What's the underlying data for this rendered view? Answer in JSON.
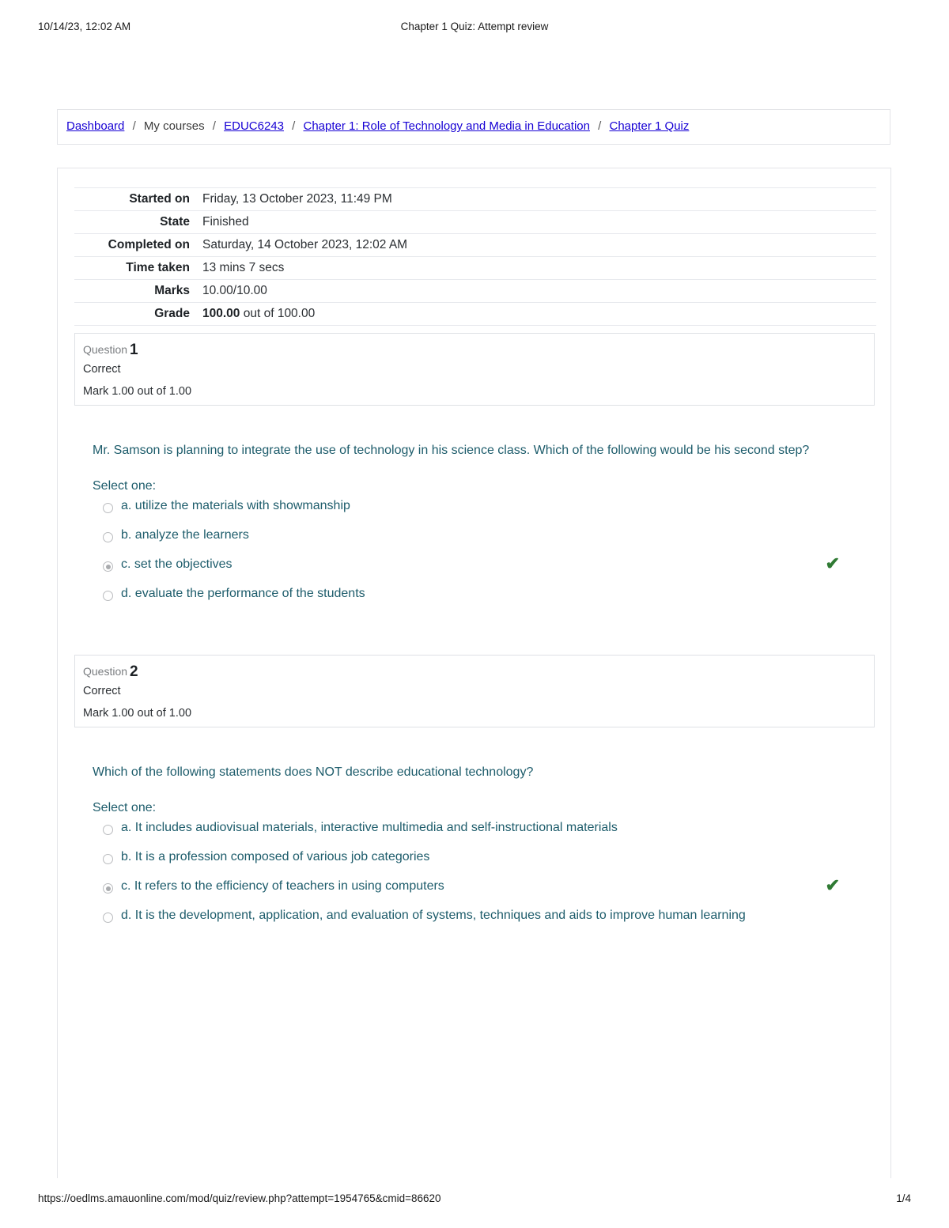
{
  "print_header": {
    "left": "10/14/23, 12:02 AM",
    "center": "Chapter 1 Quiz: Attempt review"
  },
  "print_footer": {
    "url": "https://oedlms.amauonline.com/mod/quiz/review.php?attempt=1954765&cmid=86620",
    "page": "1/4"
  },
  "breadcrumb": {
    "separator": "/",
    "items": [
      {
        "label": "Dashboard",
        "link": true
      },
      {
        "label": "My courses",
        "link": false
      },
      {
        "label": "EDUC6243",
        "link": true
      },
      {
        "label": "Chapter 1: Role of Technology and Media in Education",
        "link": true
      },
      {
        "label": "Chapter 1 Quiz",
        "link": true
      }
    ]
  },
  "summary": {
    "rows": [
      {
        "label": "Started on",
        "value": "Friday, 13 October 2023, 11:49 PM"
      },
      {
        "label": "State",
        "value": "Finished"
      },
      {
        "label": "Completed on",
        "value": "Saturday, 14 October 2023, 12:02 AM"
      },
      {
        "label": "Time taken",
        "value": "13 mins 7 secs"
      },
      {
        "label": "Marks",
        "value": "10.00/10.00"
      }
    ],
    "grade_label": "Grade",
    "grade_value_bold": "100.00",
    "grade_value_rest": "out of 100.00"
  },
  "questions": [
    {
      "number_label": "Question",
      "number": "1",
      "state": "Correct",
      "mark": "Mark 1.00 out of 1.00",
      "text": "Mr. Samson is planning to integrate the use of technology in his science class. Which of the following would be his second step?",
      "answer_label": "Select one:",
      "correct_tick": "✔",
      "options": [
        {
          "text": "a. utilize the materials with showmanship",
          "selected": false,
          "tick": false
        },
        {
          "text": "b. analyze the learners",
          "selected": false,
          "tick": false
        },
        {
          "text": "c. set the objectives",
          "selected": true,
          "tick": true
        },
        {
          "text": "d. evaluate the performance of the students",
          "selected": false,
          "tick": false
        }
      ]
    },
    {
      "number_label": "Question",
      "number": "2",
      "state": "Correct",
      "mark": "Mark 1.00 out of 1.00",
      "text": "Which of the following statements does NOT describe educational technology?",
      "answer_label": "Select one:",
      "correct_tick": "✔",
      "options": [
        {
          "text": "a. It includes audiovisual materials, interactive multimedia and self-instructional materials",
          "selected": false,
          "tick": false
        },
        {
          "text": "b. It is a profession composed of various job categories",
          "selected": false,
          "tick": false
        },
        {
          "text": "c. It refers to the efficiency of teachers in using computers",
          "selected": true,
          "tick": true
        },
        {
          "text": "d. It is the development, application, and evaluation of systems, techniques and aids to improve human learning",
          "selected": false,
          "tick": false
        }
      ]
    }
  ],
  "colors": {
    "link": "#1600d4",
    "question_text": "#1d5c6b",
    "correct_green": "#2f7a33",
    "border": "#e3e4e8"
  }
}
